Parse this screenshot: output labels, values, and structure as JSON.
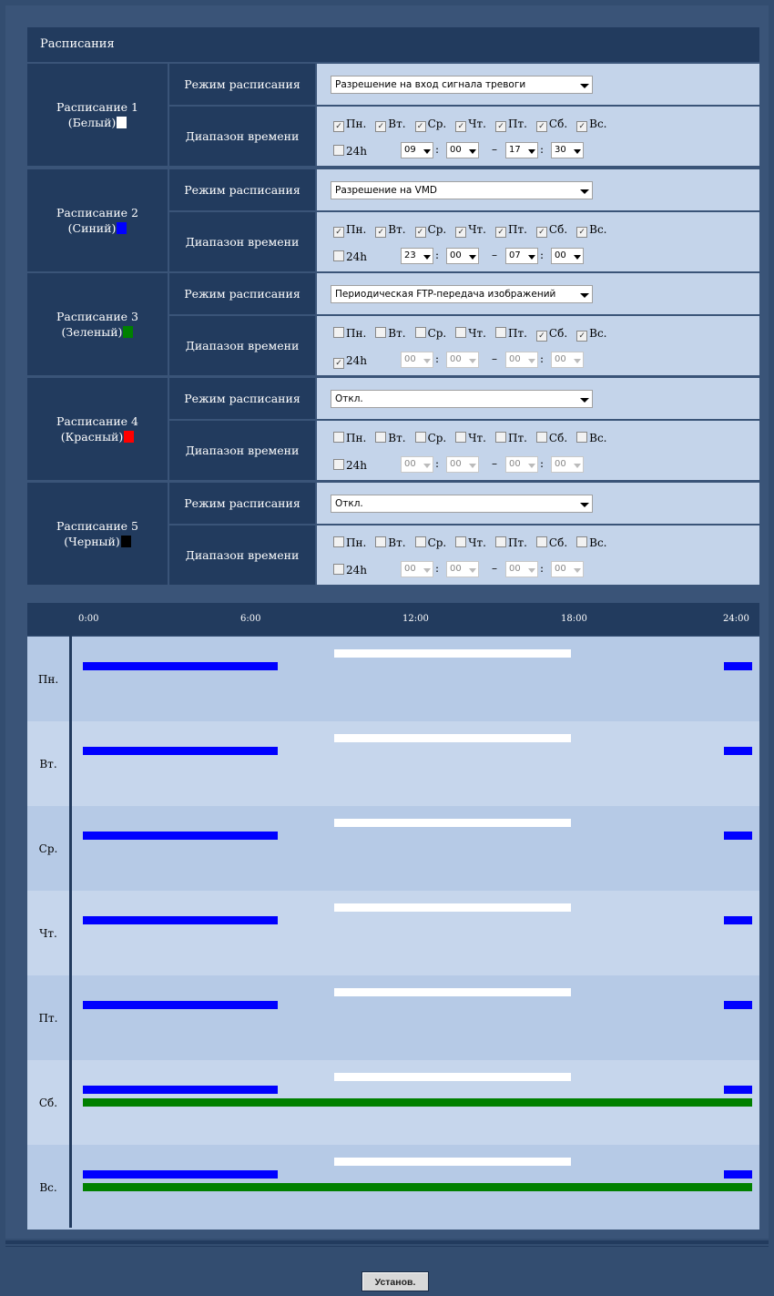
{
  "header": {
    "title": "Расписания"
  },
  "labels": {
    "mode": "Режим расписания",
    "range": "Диапазон времени",
    "h24": "24h"
  },
  "days": [
    "Пн.",
    "Вт.",
    "Ср.",
    "Чт.",
    "Пт.",
    "Сб.",
    "Вс."
  ],
  "schedules": [
    {
      "name": "Расписание 1",
      "color_name": "(Белый)",
      "color": "#ffffff",
      "mode": "Разрешение на вход сигнала тревоги",
      "mode_w": 288,
      "days_checked": [
        true,
        true,
        true,
        true,
        true,
        true,
        true
      ],
      "h24": false,
      "disabled": false,
      "start_h": "09",
      "start_m": "00",
      "end_h": "17",
      "end_m": "30"
    },
    {
      "name": "Расписание 2",
      "color_name": "(Синий)",
      "color": "#0000ff",
      "mode": "Разрешение на VMD",
      "mode_w": 288,
      "days_checked": [
        true,
        true,
        true,
        true,
        true,
        true,
        true
      ],
      "h24": false,
      "disabled": false,
      "start_h": "23",
      "start_m": "00",
      "end_h": "07",
      "end_m": "00"
    },
    {
      "name": "Расписание 3",
      "color_name": "(Зеленый)",
      "color": "#008000",
      "mode": "Периодическая FTP-передача изображений",
      "mode_w": 288,
      "days_checked": [
        false,
        false,
        false,
        false,
        false,
        true,
        true
      ],
      "h24": true,
      "disabled": true,
      "start_h": "00",
      "start_m": "00",
      "end_h": "00",
      "end_m": "00"
    },
    {
      "name": "Расписание 4",
      "color_name": "(Красный)",
      "color": "#ff0000",
      "mode": "Откл.",
      "mode_w": 288,
      "days_checked": [
        false,
        false,
        false,
        false,
        false,
        false,
        false
      ],
      "h24": false,
      "disabled": true,
      "start_h": "00",
      "start_m": "00",
      "end_h": "00",
      "end_m": "00"
    },
    {
      "name": "Расписание 5",
      "color_name": "(Черный)",
      "color": "#000000",
      "mode": "Откл.",
      "mode_w": 288,
      "days_checked": [
        false,
        false,
        false,
        false,
        false,
        false,
        false
      ],
      "h24": false,
      "disabled": true,
      "start_h": "00",
      "start_m": "00",
      "end_h": "00",
      "end_m": "00"
    }
  ],
  "timeline": {
    "ticks": [
      "0:00",
      "6:00",
      "12:00",
      "18:00",
      "24:00"
    ],
    "row_colors": [
      "#b6cae6",
      "#c6d6ec"
    ],
    "rows": [
      {
        "day": "Пн.",
        "bars": [
          {
            "color": "#ffffff",
            "start": 9,
            "end": 17.5,
            "lane": 0
          },
          {
            "color": "#0000ff",
            "start": 0,
            "end": 7,
            "lane": 1
          },
          {
            "color": "#0000ff",
            "start": 23,
            "end": 24,
            "lane": 1
          }
        ]
      },
      {
        "day": "Вт.",
        "bars": [
          {
            "color": "#ffffff",
            "start": 9,
            "end": 17.5,
            "lane": 0
          },
          {
            "color": "#0000ff",
            "start": 0,
            "end": 7,
            "lane": 1
          },
          {
            "color": "#0000ff",
            "start": 23,
            "end": 24,
            "lane": 1
          }
        ]
      },
      {
        "day": "Ср.",
        "bars": [
          {
            "color": "#ffffff",
            "start": 9,
            "end": 17.5,
            "lane": 0
          },
          {
            "color": "#0000ff",
            "start": 0,
            "end": 7,
            "lane": 1
          },
          {
            "color": "#0000ff",
            "start": 23,
            "end": 24,
            "lane": 1
          }
        ]
      },
      {
        "day": "Чт.",
        "bars": [
          {
            "color": "#ffffff",
            "start": 9,
            "end": 17.5,
            "lane": 0
          },
          {
            "color": "#0000ff",
            "start": 0,
            "end": 7,
            "lane": 1
          },
          {
            "color": "#0000ff",
            "start": 23,
            "end": 24,
            "lane": 1
          }
        ]
      },
      {
        "day": "Пт.",
        "bars": [
          {
            "color": "#ffffff",
            "start": 9,
            "end": 17.5,
            "lane": 0
          },
          {
            "color": "#0000ff",
            "start": 0,
            "end": 7,
            "lane": 1
          },
          {
            "color": "#0000ff",
            "start": 23,
            "end": 24,
            "lane": 1
          }
        ]
      },
      {
        "day": "Сб.",
        "bars": [
          {
            "color": "#ffffff",
            "start": 9,
            "end": 17.5,
            "lane": 0
          },
          {
            "color": "#0000ff",
            "start": 0,
            "end": 7,
            "lane": 1
          },
          {
            "color": "#0000ff",
            "start": 23,
            "end": 24,
            "lane": 1
          },
          {
            "color": "#008000",
            "start": 0,
            "end": 24,
            "lane": 2
          }
        ]
      },
      {
        "day": "Вс.",
        "bars": [
          {
            "color": "#ffffff",
            "start": 9,
            "end": 17.5,
            "lane": 0
          },
          {
            "color": "#0000ff",
            "start": 0,
            "end": 7,
            "lane": 1
          },
          {
            "color": "#0000ff",
            "start": 23,
            "end": 24,
            "lane": 1
          },
          {
            "color": "#008000",
            "start": 0,
            "end": 24,
            "lane": 2
          }
        ]
      }
    ]
  },
  "submit": {
    "label": "Установ."
  }
}
